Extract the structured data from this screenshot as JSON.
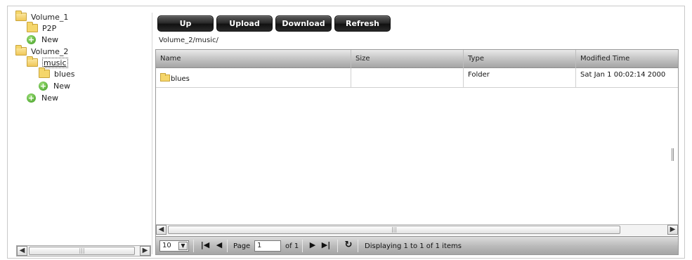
{
  "tree": {
    "items": [
      {
        "label": "Volume_1",
        "icon": "folder-open-icon"
      },
      {
        "label": "P2P",
        "icon": "folder-icon"
      },
      {
        "label": "New",
        "icon": "add-icon"
      },
      {
        "label": "Volume_2",
        "icon": "folder-open-icon"
      },
      {
        "label": "music",
        "icon": "folder-open-icon",
        "selected": true
      },
      {
        "label": "blues",
        "icon": "folder-icon"
      },
      {
        "label": "New",
        "icon": "add-icon"
      },
      {
        "label": "New",
        "icon": "add-icon"
      }
    ]
  },
  "toolbar": {
    "up_label": "Up",
    "upload_label": "Upload",
    "download_label": "Download",
    "refresh_label": "Refresh"
  },
  "current_path": "Volume_2/music/",
  "grid": {
    "columns": [
      "Name",
      "Size",
      "Type",
      "Modified Time"
    ],
    "rows": [
      {
        "name": "blues",
        "size": "",
        "type": "Folder",
        "modified": "Sat Jan 1 00:02:14 2000"
      }
    ]
  },
  "pager": {
    "page_size": "10",
    "page_label": "Page",
    "page_value": "1",
    "of_label": "of 1",
    "status": "Displaying 1 to 1 of 1 items"
  },
  "colors": {
    "button_dark": "#1a1a1a",
    "header_gray": "#b8b8b8",
    "folder_yellow": "#f5d66b",
    "add_green": "#3c9a1f"
  }
}
